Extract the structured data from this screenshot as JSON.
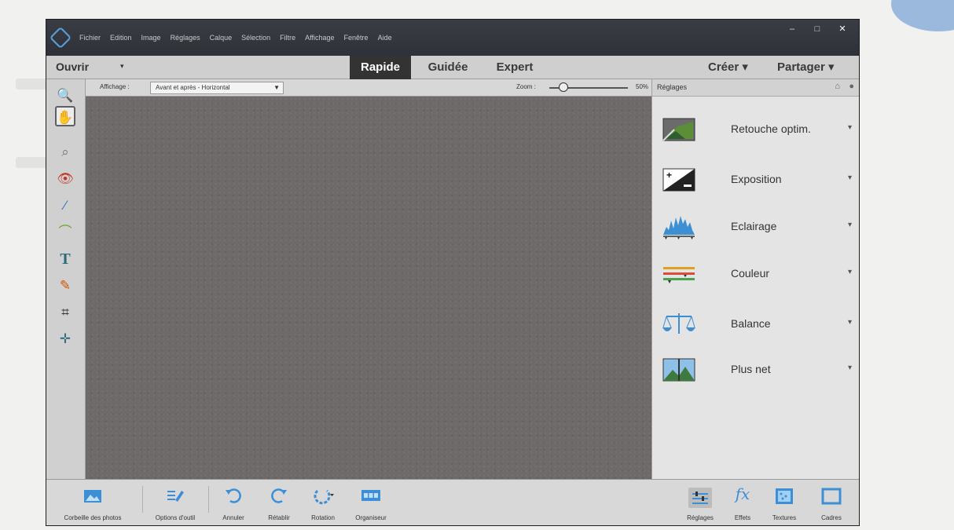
{
  "window": {
    "menu": [
      "Fichier",
      "Edition",
      "Image",
      "Réglages",
      "Calque",
      "Sélection",
      "Filtre",
      "Affichage",
      "Fenêtre",
      "Aide"
    ],
    "controls": {
      "minimize": "–",
      "maximize": "□",
      "close": "✕"
    }
  },
  "modebar": {
    "open_label": "Ouvrir",
    "open_arrow": "▾",
    "tabs": [
      "Rapide",
      "Guidée",
      "Expert"
    ],
    "active_tab": "Rapide",
    "create_label": "Créer ▾",
    "share_label": "Partager ▾"
  },
  "options": {
    "view_label": "Affichage :",
    "view_value": "Avant et après - Horizontal",
    "view_arrow": "▼",
    "zoom_label": "Zoom :",
    "zoom_value": "50%"
  },
  "tools": [
    {
      "name": "zoom-tool",
      "glyph": "🔍"
    },
    {
      "name": "hand-tool",
      "glyph": "✋"
    },
    {
      "name": "quick-selection-tool",
      "glyph": "⌕"
    },
    {
      "name": "red-eye-tool",
      "glyph": "👁"
    },
    {
      "name": "whiten-teeth-tool",
      "glyph": "⁄"
    },
    {
      "name": "straighten-tool",
      "glyph": "⌒"
    },
    {
      "name": "text-tool",
      "glyph": "T"
    },
    {
      "name": "spot-healing-tool",
      "glyph": "✎"
    },
    {
      "name": "crop-tool",
      "glyph": "⌗"
    },
    {
      "name": "move-tool",
      "glyph": "✛"
    }
  ],
  "panel": {
    "title": "Réglages",
    "items": [
      "Retouche optim.",
      "Exposition",
      "Eclairage",
      "Couleur",
      "Balance",
      "Plus net"
    ],
    "arrow": "▾"
  },
  "bottombar": {
    "left": [
      "Corbeille des photos",
      "Options d'outil",
      "Annuler",
      "Rétablir",
      "Rotation",
      "Organiseur"
    ],
    "right": [
      "Réglages",
      "Effets",
      "Textures",
      "Cadres"
    ],
    "effects_glyph": "fx"
  },
  "colors": {
    "accent": "#3c8ed6",
    "canvas": "#6d6a69",
    "chrome": "#2f3138"
  }
}
